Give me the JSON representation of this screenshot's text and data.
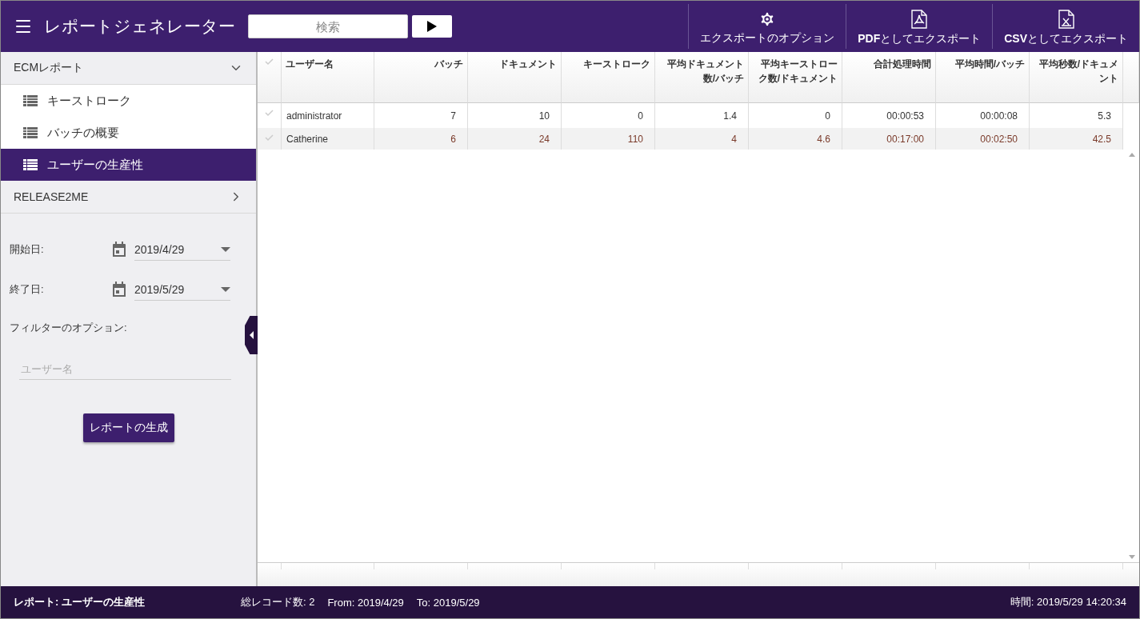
{
  "app": {
    "title": "レポートジェネレーター",
    "search": {
      "placeholder": "検索"
    }
  },
  "toolbar": [
    {
      "kind": "gear",
      "label": "エクスポートのオプション"
    },
    {
      "kind": "pdf",
      "label": "**PDF**としてエクスポート"
    },
    {
      "kind": "csv",
      "label": "**CSV**としてエクスポート"
    }
  ],
  "sidebar": {
    "groups": [
      {
        "label": "ECMレポート",
        "expanded": true,
        "children": [
          {
            "label": "キーストローク",
            "selected": false
          },
          {
            "label": "バッチの概要",
            "selected": false
          },
          {
            "label": "ユーザーの生産性",
            "selected": true
          }
        ]
      },
      {
        "label": "RELEASE2ME",
        "expanded": false
      }
    ],
    "fields": [
      {
        "label": "開始日:",
        "value": "2019/4/29"
      },
      {
        "label": "終了日:",
        "value": "2019/5/29"
      }
    ],
    "filter_label": "フィルターのオプション:",
    "filter_placeholder": "ユーザー名",
    "generate": "レポートの生成"
  },
  "table": {
    "columns": [
      "ユーザー名",
      "バッチ",
      "ドキュメント",
      "キーストローク",
      "平均ドキュメント数/バッチ",
      "平均キーストローク数/ドキュメント",
      "合計処理時間",
      "平均時間/バッチ",
      "平均秒数/ドキュメント"
    ],
    "rows": [
      {
        "selected": false,
        "cells": [
          "administrator",
          "7",
          "10",
          "0",
          "1.4",
          "0",
          "00:00:53",
          "00:00:08",
          "5.3"
        ]
      },
      {
        "selected": true,
        "cells": [
          "Catherine",
          "6",
          "24",
          "110",
          "4",
          "4.6",
          "00:17:00",
          "00:02:50",
          "42.5"
        ]
      }
    ]
  },
  "status_bar": {
    "report": "レポート: ユーザーの生産性",
    "count": "総レコード数: 2",
    "from": "From: 2019/4/29",
    "to": "To: 2019/5/29",
    "time": "時間: 2019/5/29 14:20:34"
  }
}
